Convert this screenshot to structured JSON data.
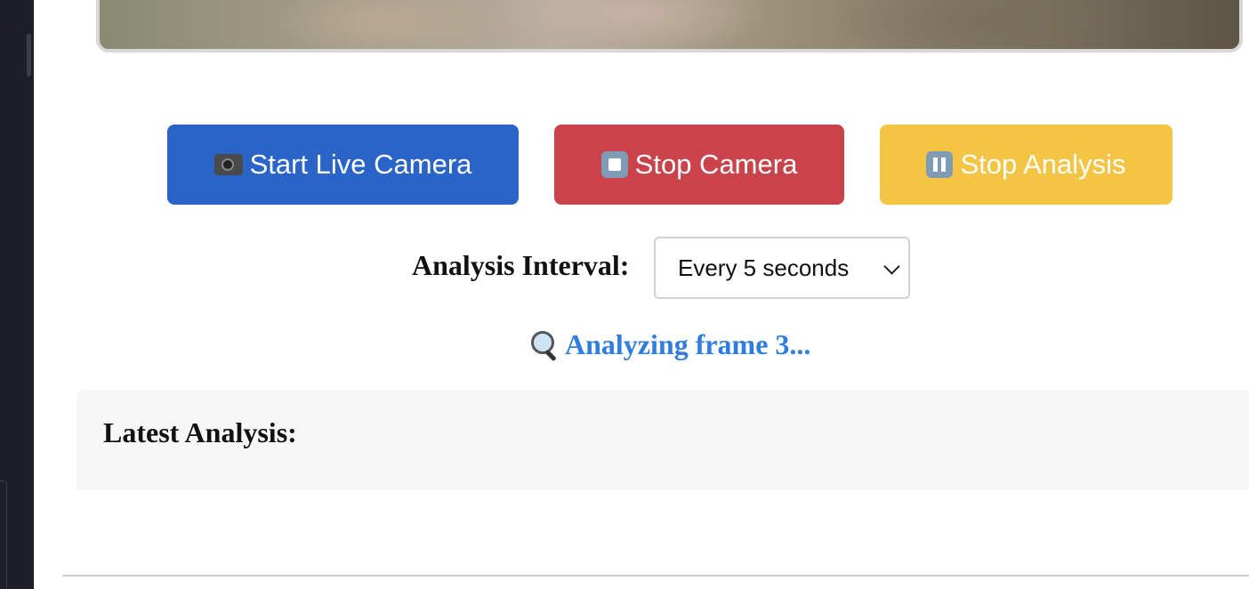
{
  "buttons": {
    "start_camera": {
      "emoji": "📹",
      "label": "Start Live Camera",
      "color": "#2a64c8"
    },
    "stop_camera": {
      "emoji": "⏹️",
      "label": "Stop Camera",
      "color": "#cb434a"
    },
    "stop_analysis": {
      "emoji": "⏸️",
      "label": "Stop Analysis",
      "color": "#f4c544"
    }
  },
  "interval": {
    "label": "Analysis Interval:",
    "selected": "Every 5 seconds"
  },
  "status": {
    "icon": "magnifier-icon",
    "text": "Analyzing frame 3...",
    "color": "#2f7de0"
  },
  "analysis": {
    "heading": "Latest Analysis:"
  }
}
